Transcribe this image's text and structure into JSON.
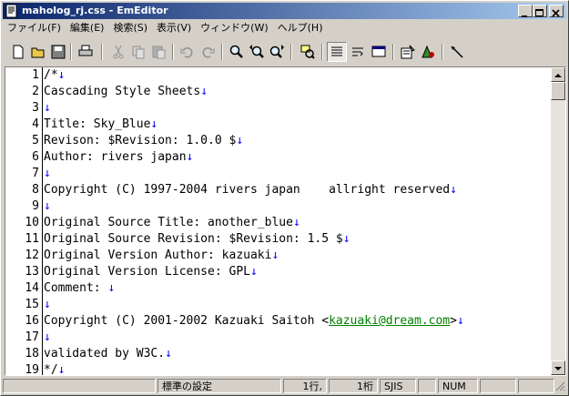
{
  "window": {
    "title": "maholog_rj.css - EmEditor"
  },
  "menu": [
    {
      "label": "ファイル(F)"
    },
    {
      "label": "編集(E)"
    },
    {
      "label": "検索(S)"
    },
    {
      "label": "表示(V)"
    },
    {
      "label": "ウィンドウ(W)"
    },
    {
      "label": "ヘルプ(H)"
    }
  ],
  "toolbar": {
    "buttons": [
      "new-file-icon",
      "open-folder-icon",
      "save-icon",
      "print-icon",
      "cut-icon",
      "copy-icon",
      "paste-icon",
      "undo-icon",
      "redo-icon",
      "find-icon",
      "find-prev-icon",
      "find-next-icon",
      "highlight-icon",
      "wordwrap-none-icon",
      "wordwrap-window-icon",
      "window-icon",
      "properties-icon",
      "macro-icon",
      "tool-icon"
    ]
  },
  "lines": [
    {
      "num": "1",
      "text": "/*",
      "nl": "↓"
    },
    {
      "num": "2",
      "text": "Cascading Style Sheets",
      "nl": "↓"
    },
    {
      "num": "3",
      "text": "",
      "nl": "↓"
    },
    {
      "num": "4",
      "text": "Title: Sky_Blue",
      "nl": "↓"
    },
    {
      "num": "5",
      "text": "Revison: $Revision: 1.0.0 $",
      "nl": "↓"
    },
    {
      "num": "6",
      "text": "Author: rivers japan",
      "nl": "↓"
    },
    {
      "num": "7",
      "text": "",
      "nl": "↓"
    },
    {
      "num": "8",
      "text": "Copyright (C) 1997-2004 rivers japan    allright reserved",
      "nl": "↓"
    },
    {
      "num": "9",
      "text": "",
      "nl": "↓"
    },
    {
      "num": "10",
      "text": "Original Source Title: another_blue",
      "nl": "↓"
    },
    {
      "num": "11",
      "text": "Original Source Revision: $Revision: 1.5 $",
      "nl": "↓"
    },
    {
      "num": "12",
      "text": "Original Version Author: kazuaki",
      "nl": "↓"
    },
    {
      "num": "13",
      "text": "Original Version License: GPL",
      "nl": "↓"
    },
    {
      "num": "14",
      "text": "Comment: ",
      "nl": "↓"
    },
    {
      "num": "15",
      "text": "",
      "nl": "↓"
    },
    {
      "num": "16",
      "text": "Copyright (C) 2001-2002 Kazuaki Saitoh <",
      "link": "kazuaki@dream.com",
      "after": ">",
      "nl": "↓"
    },
    {
      "num": "17",
      "text": "",
      "nl": "↓"
    },
    {
      "num": "18",
      "text": "validated by W3C.",
      "nl": "↓"
    },
    {
      "num": "19",
      "text": "*/",
      "nl": "↓"
    }
  ],
  "status": {
    "config": "標準の設定",
    "line": "1行,",
    "col": "1桁",
    "encoding": "SJIS",
    "num": "NUM"
  }
}
